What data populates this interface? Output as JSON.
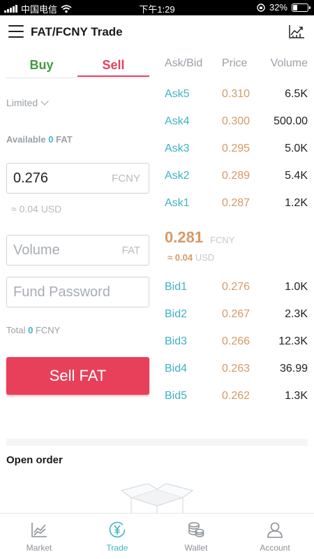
{
  "status_bar": {
    "carrier": "中国电信",
    "time": "下午1:29",
    "battery": "32%",
    "battery_level": 0.32
  },
  "header": {
    "title": "FAT/FCNY Trade",
    "menu_icon": "hamburger-menu-icon",
    "chart_icon": "line-chart-icon"
  },
  "trade_form": {
    "tab_buy": "Buy",
    "tab_sell": "Sell",
    "active_tab": "Sell",
    "order_type": "Limited",
    "available_label": "Available",
    "available_amount": "0",
    "available_unit": "FAT",
    "price_value": "0.276",
    "price_unit": "FCNY",
    "price_usd": "≈ 0.04 USD",
    "volume_placeholder": "Volume",
    "volume_unit": "FAT",
    "password_placeholder": "Fund Password",
    "total_label": "Total",
    "total_amount": "0",
    "total_unit": "FCNY",
    "submit_label": "Sell FAT"
  },
  "order_book": {
    "headers": {
      "side": "Ask/Bid",
      "price": "Price",
      "volume": "Volume"
    },
    "asks": [
      {
        "label": "Ask5",
        "price": "0.310",
        "volume": "6.5K"
      },
      {
        "label": "Ask4",
        "price": "0.300",
        "volume": "500.00"
      },
      {
        "label": "Ask3",
        "price": "0.295",
        "volume": "5.0K"
      },
      {
        "label": "Ask2",
        "price": "0.289",
        "volume": "5.4K"
      },
      {
        "label": "Ask1",
        "price": "0.287",
        "volume": "1.2K"
      }
    ],
    "last_price": "0.281",
    "last_price_unit": "FCNY",
    "last_usd_prefix": "≈ 0.04",
    "last_usd_unit": "USD",
    "bids": [
      {
        "label": "Bid1",
        "price": "0.276",
        "volume": "1.0K"
      },
      {
        "label": "Bid2",
        "price": "0.267",
        "volume": "2.3K"
      },
      {
        "label": "Bid3",
        "price": "0.266",
        "volume": "12.3K"
      },
      {
        "label": "Bid4",
        "price": "0.263",
        "volume": "36.99"
      },
      {
        "label": "Bid5",
        "price": "0.262",
        "volume": "1.3K"
      }
    ]
  },
  "open_orders": {
    "title": "Open order",
    "empty_icon": "empty-box-icon"
  },
  "tabbar": {
    "items": [
      {
        "label": "Market",
        "icon": "market-chart-icon"
      },
      {
        "label": "Trade",
        "icon": "yuan-coin-icon"
      },
      {
        "label": "Wallet",
        "icon": "coins-stack-icon"
      },
      {
        "label": "Account",
        "icon": "person-icon"
      }
    ],
    "active": "Trade"
  },
  "colors": {
    "sell": "#e8405a",
    "buy": "#3f9b3f",
    "teal": "#3eb3c1",
    "price": "#d59a66"
  }
}
